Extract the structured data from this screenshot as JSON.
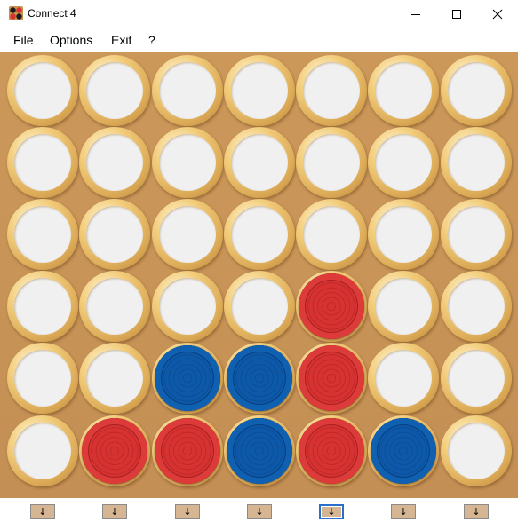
{
  "window": {
    "title": "Connect 4",
    "app_icon": "connect4-app-icon",
    "controls": [
      "minimize-icon",
      "maximize-icon",
      "close-icon"
    ]
  },
  "menu": [
    {
      "label": "File"
    },
    {
      "label": "Options"
    },
    {
      "label": "Exit"
    },
    {
      "label": "?"
    }
  ],
  "board": {
    "columns": 7,
    "rows": 6,
    "grid": [
      [
        "empty",
        "empty",
        "empty",
        "empty",
        "empty",
        "empty",
        "empty"
      ],
      [
        "empty",
        "empty",
        "empty",
        "empty",
        "empty",
        "empty",
        "empty"
      ],
      [
        "empty",
        "empty",
        "empty",
        "empty",
        "empty",
        "empty",
        "empty"
      ],
      [
        "empty",
        "empty",
        "empty",
        "empty",
        "red",
        "empty",
        "empty"
      ],
      [
        "empty",
        "empty",
        "blue",
        "blue",
        "red",
        "empty",
        "empty"
      ],
      [
        "empty",
        "red",
        "red",
        "blue",
        "red",
        "blue",
        "empty"
      ]
    ],
    "colors": {
      "board": "#c99558",
      "red": "#d63232",
      "blue": "#0d58a8",
      "empty": "#f0f0f0"
    }
  },
  "drop_buttons": {
    "label": "↓",
    "focused_column": 4
  }
}
